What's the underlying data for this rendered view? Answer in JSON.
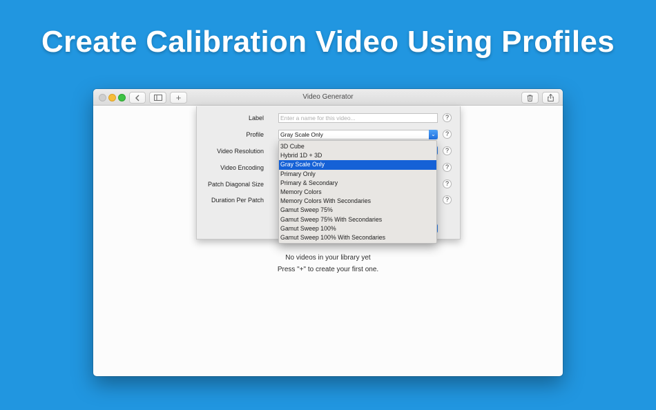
{
  "headline": "Create Calibration Video Using Profiles",
  "window": {
    "title": "Video Generator",
    "toolbar": {
      "back_icon": "chevron-left-icon",
      "sidebar_icon": "sidebar-icon",
      "add_label": "+",
      "trash_icon": "trash-icon",
      "share_icon": "share-icon"
    },
    "empty_state": {
      "line1": "No videos in your library yet",
      "line2": "Press \"+\" to create your first one."
    }
  },
  "form": {
    "label": {
      "title": "Label",
      "placeholder": "Enter a name for this video...",
      "value": ""
    },
    "profile": {
      "title": "Profile",
      "value": "Gray Scale Only"
    },
    "video_resolution": {
      "title": "Video Resolution"
    },
    "video_encoding": {
      "title": "Video Encoding"
    },
    "patch_diagonal_size": {
      "title": "Patch Diagonal Size"
    },
    "duration_per_patch": {
      "title": "Duration Per Patch"
    },
    "help_label": "?"
  },
  "profile_dropdown": {
    "options": [
      "3D Cube",
      "Hybrid 1D + 3D",
      "Gray Scale Only",
      "Primary Only",
      "Primary & Secondary",
      "Memory Colors",
      "Memory Colors With Secondaries",
      "Gamut Sweep 75%",
      "Gamut Sweep 75% With Secondaries",
      "Gamut Sweep 100%",
      "Gamut Sweep 100% With Secondaries"
    ],
    "selected": "Gray Scale Only",
    "colors": {
      "highlight": "#1561d6",
      "background": "#e8e6e3"
    }
  },
  "colors": {
    "page_background": "#2196e0",
    "accent": "#2a7be6"
  }
}
